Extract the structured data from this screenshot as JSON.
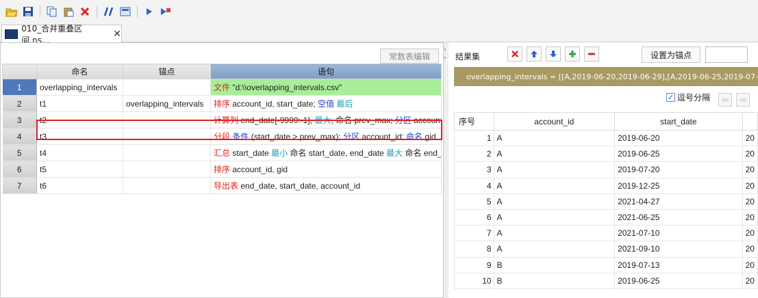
{
  "toolbar": {
    "icons": [
      "open-icon",
      "save-icon",
      "copy-icon",
      "paste-icon",
      "delete-icon",
      "comment-icon",
      "calc-icon",
      "run-icon",
      "debug-icon"
    ]
  },
  "tab": {
    "label": "010_合并重叠区间.ns..."
  },
  "left": {
    "const_button": "常数表编辑",
    "headers": {
      "name": "命名",
      "anchor": "锚点",
      "statement": "语句"
    },
    "rows": [
      {
        "num": "1",
        "name": "overlapping_intervals",
        "anchor": "",
        "parts": [
          [
            "kw-red",
            "文件"
          ],
          [
            "",
            " \"d:\\\\overlapping_intervals.csv\""
          ]
        ]
      },
      {
        "num": "2",
        "name": "t1",
        "anchor": "overlapping_intervals",
        "parts": [
          [
            "kw-red",
            "排序"
          ],
          [
            "",
            " account_id, start_date; "
          ],
          [
            "kw-blue",
            "空值"
          ],
          [
            "",
            " "
          ],
          [
            "kw-cyan",
            "最后"
          ]
        ]
      },
      {
        "num": "3",
        "name": "t2",
        "anchor": "",
        "parts": [
          [
            "kw-red",
            "计算列"
          ],
          [
            "",
            " end_date[-9999:-1], "
          ],
          [
            "kw-cyan",
            "最大"
          ],
          [
            "",
            ", 命名 prev_max; "
          ],
          [
            "kw-blue",
            "分区"
          ],
          [
            "",
            " account_"
          ]
        ]
      },
      {
        "num": "4",
        "name": "t3",
        "anchor": "",
        "parts": [
          [
            "kw-red",
            "分段"
          ],
          [
            "",
            " "
          ],
          [
            "kw-blue",
            "条件"
          ],
          [
            "",
            " (start_date > prev_max); "
          ],
          [
            "kw-blue",
            "分区"
          ],
          [
            "",
            " account_id; "
          ],
          [
            "kw-blue",
            "命名"
          ],
          [
            "",
            " gid"
          ]
        ]
      },
      {
        "num": "5",
        "name": "t4",
        "anchor": "",
        "parts": [
          [
            "kw-red",
            "汇总"
          ],
          [
            "",
            " start_date "
          ],
          [
            "kw-cyan",
            "最小"
          ],
          [
            "",
            " 命名 start_date, end_date "
          ],
          [
            "kw-cyan",
            "最大"
          ],
          [
            "",
            " 命名 end_d"
          ]
        ]
      },
      {
        "num": "6",
        "name": "t5",
        "anchor": "",
        "parts": [
          [
            "kw-red",
            "排序"
          ],
          [
            "",
            " account_id, gid"
          ]
        ]
      },
      {
        "num": "7",
        "name": "t6",
        "anchor": "",
        "parts": [
          [
            "kw-red",
            "导出表"
          ],
          [
            "",
            " end_date, start_date, account_id"
          ]
        ]
      }
    ]
  },
  "right": {
    "title": "结果集",
    "anchor_button": "设置为锚点",
    "result_text": "overlapping_intervals = [[A,2019-06-20,2019-06-29],[A,2019-06-25,2019-07-2",
    "comma_label": "逗号分隔",
    "columns": [
      "序号",
      "account_id",
      "start_date",
      ""
    ],
    "rows": [
      [
        "1",
        "A",
        "2019-06-20",
        "20"
      ],
      [
        "2",
        "A",
        "2019-06-25",
        "20"
      ],
      [
        "3",
        "A",
        "2019-07-20",
        "20"
      ],
      [
        "4",
        "A",
        "2019-12-25",
        "20"
      ],
      [
        "5",
        "A",
        "2021-04-27",
        "20"
      ],
      [
        "6",
        "A",
        "2021-06-25",
        "20"
      ],
      [
        "7",
        "A",
        "2021-07-10",
        "20"
      ],
      [
        "8",
        "A",
        "2021-09-10",
        "20"
      ],
      [
        "9",
        "B",
        "2019-07-13",
        "20"
      ],
      [
        "10",
        "B",
        "2019-06-25",
        "20"
      ]
    ]
  }
}
